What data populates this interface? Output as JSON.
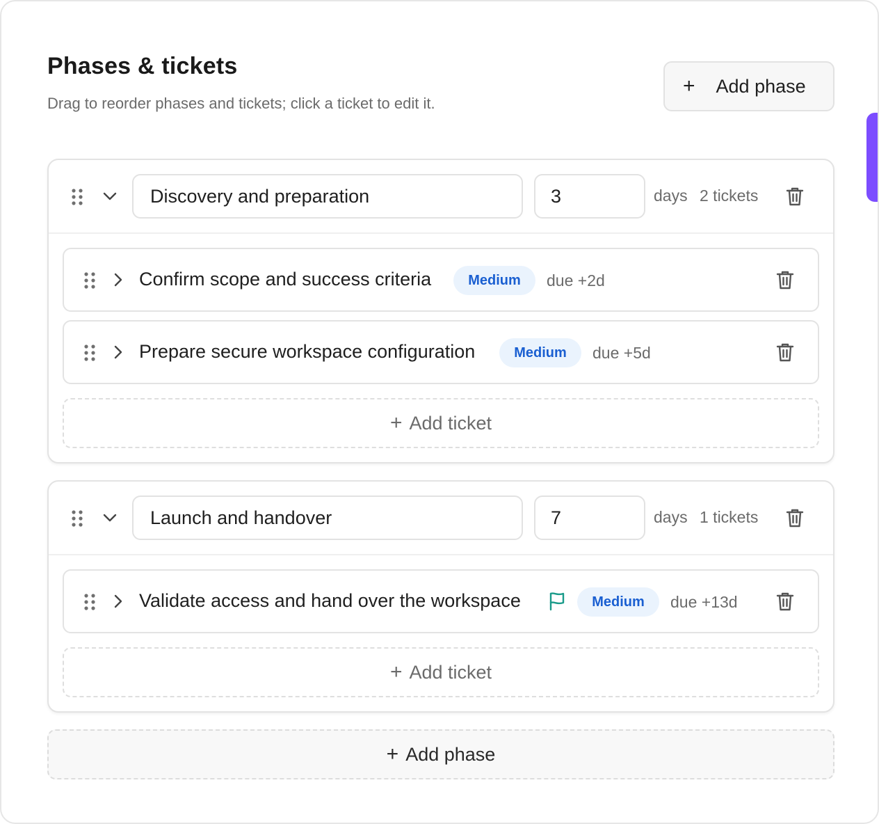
{
  "header": {
    "title": "Phases & tickets",
    "subtitle": "Drag to reorder phases and tickets; click a ticket to edit it.",
    "add_phase_label": "Add phase",
    "add_phase_icon": "plus-icon"
  },
  "phases": [
    {
      "name": "Discovery and preparation",
      "days": "3",
      "days_label": "days",
      "tickets_count": "2 tickets",
      "tickets": [
        {
          "title": "Confirm scope and success criteria",
          "priority": "Medium",
          "due": "due +2d",
          "flagged": false
        },
        {
          "title": "Prepare secure workspace configuration",
          "priority": "Medium",
          "due": "due +5d",
          "flagged": false
        }
      ],
      "add_ticket_label": "Add ticket"
    },
    {
      "name": "Launch and handover",
      "days": "7",
      "days_label": "days",
      "tickets_count": "1 tickets",
      "tickets": [
        {
          "title": "Validate access and hand over the workspace",
          "priority": "Medium",
          "due": "due +13d",
          "flagged": true
        }
      ],
      "add_ticket_label": "Add ticket"
    }
  ],
  "footer": {
    "add_phase_label": "Add phase"
  },
  "colors": {
    "accent_tab": "#7c4dff",
    "badge_bg": "#eaf3fd",
    "badge_text": "#1a5fd1",
    "flag": "#1a9b8a",
    "muted_text": "#6b6b6b"
  },
  "icons": {
    "drag": "drag-handle-icon",
    "expand": "chevron-down-icon",
    "collapse": "chevron-right-icon",
    "delete": "trash-icon",
    "flag": "flag-icon"
  }
}
